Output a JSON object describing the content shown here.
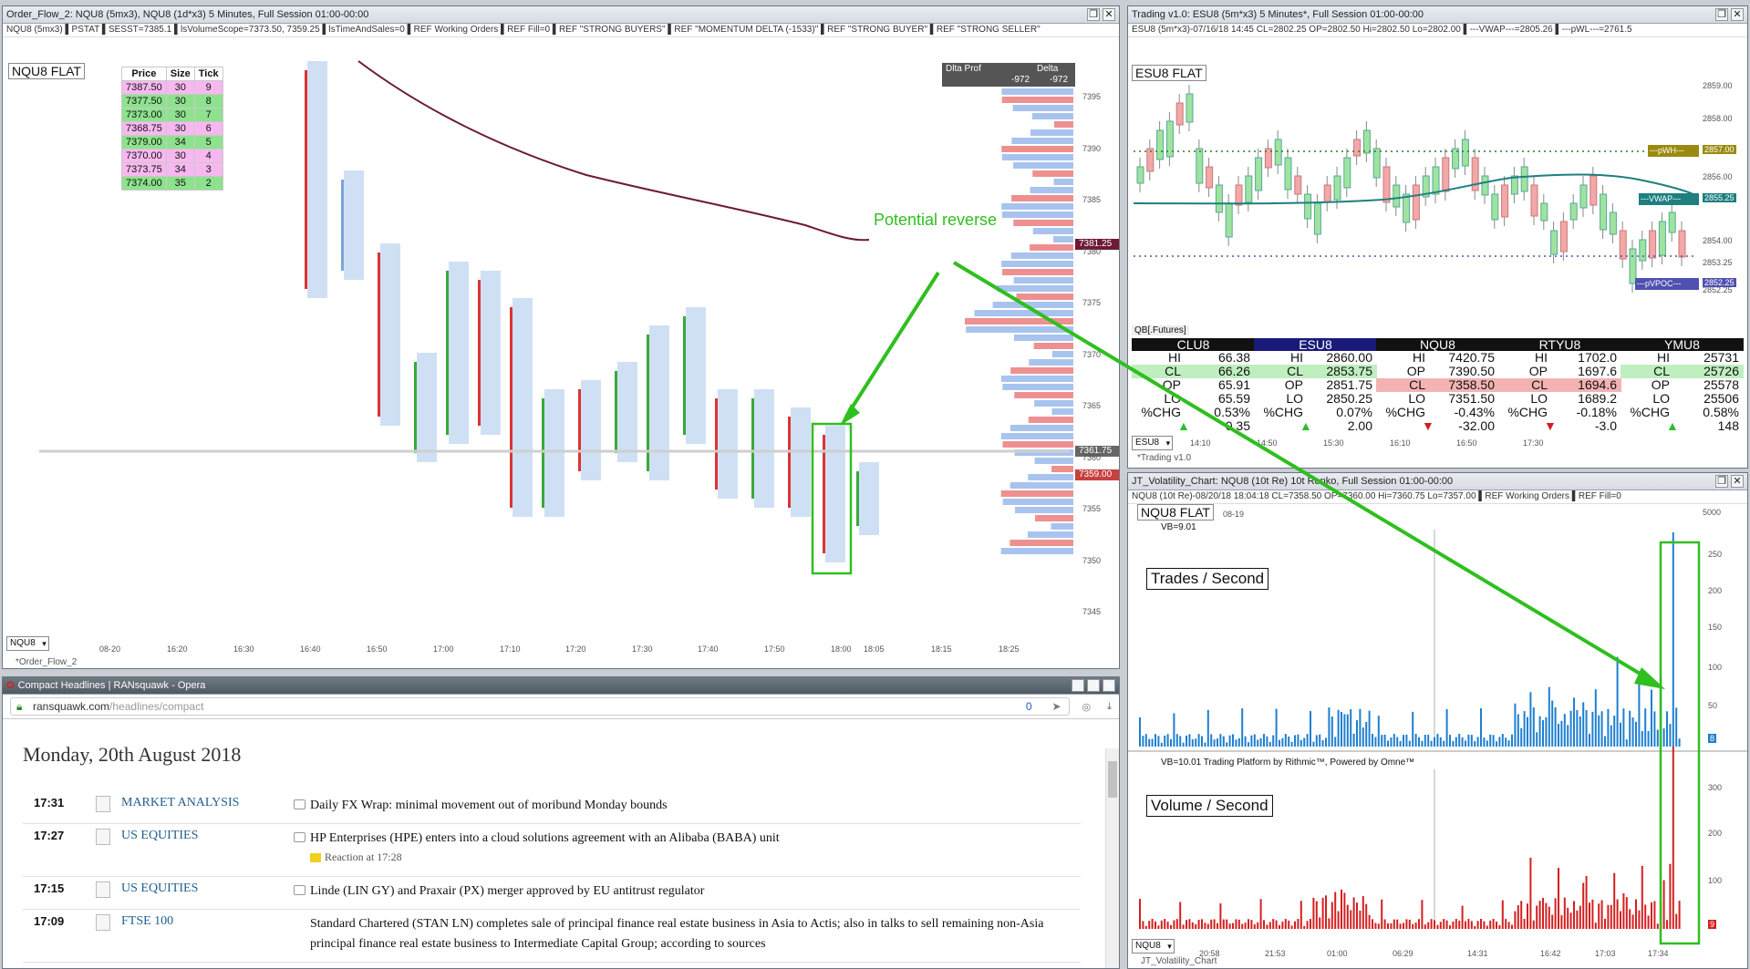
{
  "orderflow": {
    "title": "Order_Flow_2: NQU8 (5mx3), NQU8 (1d*x3) 5 Minutes, Full Session 01:00-00:00",
    "info": "NQU8 (5mx3) ▌PSTAT ▌SESST=7385.1 ▌lsVolumeScope=7373.50, 7359.25 ▌lsTimeAndSales=0 ▌REF Working Orders ▌REF Fill=0 ▌REF \"STRONG BUYERS\" ▌REF \"MOMENTUM DELTA (-1533)\" ▌REF \"STRONG BUYER\" ▌REF \"STRONG SELLER\"",
    "flat": "NQU8 FLAT",
    "table_headers": [
      "Price",
      "Size",
      "Tick"
    ],
    "table_rows": [
      {
        "price": "7387.50",
        "size": "30",
        "tick": "9",
        "color": "pink"
      },
      {
        "price": "7377.50",
        "size": "30",
        "tick": "8",
        "color": "green"
      },
      {
        "price": "7373.00",
        "size": "30",
        "tick": "7",
        "color": "green"
      },
      {
        "price": "7368.75",
        "size": "30",
        "tick": "6",
        "color": "pink"
      },
      {
        "price": "7379.00",
        "size": "34",
        "tick": "5",
        "color": "green"
      },
      {
        "price": "7370.00",
        "size": "30",
        "tick": "4",
        "color": "pink"
      },
      {
        "price": "7373.75",
        "size": "34",
        "tick": "3",
        "color": "pink"
      },
      {
        "price": "7374.00",
        "size": "35",
        "tick": "2",
        "color": "green"
      }
    ],
    "dlta_prof": "Dlta Prof",
    "delta": "Delta",
    "delta_val1": "-972",
    "delta_val2": "-972",
    "annotation": "Potential reverse",
    "price_labels": [
      "7395",
      "7390",
      "7385",
      "7380",
      "7375",
      "7370",
      "7365",
      "7360",
      "7355",
      "7350",
      "7345"
    ],
    "price_tag_1": "7381.25",
    "price_tag_2": "7361.75",
    "price_tag_3": "7359.00",
    "time_labels": [
      "08-20",
      "16:20",
      "16:30",
      "16:40",
      "16:50",
      "17:00",
      "17:10",
      "17:20",
      "17:30",
      "17:40",
      "17:50",
      "18:00",
      "18:05",
      "18:15",
      "18:25"
    ],
    "symbol": "NQU8",
    "tab": "*Order_Flow_2",
    "cell_m": "M"
  },
  "trading": {
    "title": "Trading v1.0: ESU8 (5m*x3) 5 Minutes*, Full Session 01:00-00:00",
    "info": "ESU8 (5m*x3)-07/16/18 14:45 CL=2802.25 OP=2802.50 Hi=2802.50 Lo=2802.00 ▌---VWAP---=2805.26 ▌---pWL---=2761.5",
    "flat": "ESU8 FLAT",
    "price_labels": [
      "2859.00",
      "2858.00",
      "2856.00",
      "2855.25",
      "2854.00",
      "2853.25",
      "2852.25"
    ],
    "tag_pwh": "---pWH---",
    "tag_pwh_val": "2857.00",
    "tag_vwap": "---VWAP---",
    "tag_vwap_val": "2855.25",
    "tag_pvpoc": "---pVPOC---",
    "tag_pvpoc_val": "2852.25",
    "qb_tab": "QB[.Futures]",
    "quotes": [
      {
        "sym": "CLU8",
        "rows": [
          [
            "HI",
            "66.38"
          ],
          [
            "CL",
            "66.26"
          ],
          [
            "OP",
            "65.91"
          ],
          [
            "LO",
            "65.59"
          ],
          [
            "%CHG",
            "0.53%"
          ]
        ],
        "chg": "0.35",
        "dir": "up",
        "hdr": "#111"
      },
      {
        "sym": "ESU8",
        "rows": [
          [
            "HI",
            "2860.00"
          ],
          [
            "CL",
            "2853.75"
          ],
          [
            "OP",
            "2851.75"
          ],
          [
            "LO",
            "2850.25"
          ],
          [
            "%CHG",
            "0.07%"
          ]
        ],
        "chg": "2.00",
        "dir": "up",
        "hdr": "#1a1a7a"
      },
      {
        "sym": "NQU8",
        "rows": [
          [
            "HI",
            "7420.75"
          ],
          [
            "OP",
            "7390.50"
          ],
          [
            "CL",
            "7358.50"
          ],
          [
            "LO",
            "7351.50"
          ],
          [
            "%CHG",
            "-0.43%"
          ]
        ],
        "chg": "-32.00",
        "dir": "down",
        "hdr": "#111"
      },
      {
        "sym": "RTYU8",
        "rows": [
          [
            "HI",
            "1702.0"
          ],
          [
            "OP",
            "1697.6"
          ],
          [
            "CL",
            "1694.6"
          ],
          [
            "LO",
            "1689.2"
          ],
          [
            "%CHG",
            "-0.18%"
          ]
        ],
        "chg": "-3.0",
        "dir": "down",
        "hdr": "#111"
      },
      {
        "sym": "YMU8",
        "rows": [
          [
            "HI",
            "25731"
          ],
          [
            "CL",
            "25726"
          ],
          [
            "OP",
            "25578"
          ],
          [
            "LO",
            "25506"
          ],
          [
            "%CHG",
            "0.58%"
          ]
        ],
        "chg": "148",
        "dir": "up",
        "hdr": "#111"
      }
    ],
    "time_labels": [
      "14:10",
      "14:50",
      "15:30",
      "16:10",
      "16:50",
      "17:30"
    ],
    "symbol": "ESU8",
    "tab": "*Trading v1.0"
  },
  "volatility": {
    "title": "JT_Volatility_Chart: NQU8 (10t Re) 10t Renko, Full Session 01:00-00:00",
    "info": "NQU8 (10t Re)-08/20/18 18:04:18 CL=7358.50 OP=7360.00 Hi=7360.75 Lo=7357.00 ▌REF Working Orders ▌REF Fill=0",
    "flat": "NQU8 FLAT",
    "vb1": "VB=9.01",
    "vb2": "VB=10.01  Trading Platform by Rithmic™, Powered by Omne™",
    "label1": "Trades / Second",
    "label2": "Volume / Second",
    "date": "08-19",
    "top_val": "5000",
    "axis1": [
      "250",
      "200",
      "150",
      "100",
      "50"
    ],
    "axis2": [
      "300",
      "200",
      "100"
    ],
    "last1": "8",
    "last2": "9",
    "time_labels": [
      "20:58",
      "21:53",
      "01:00",
      "06:29",
      "14:31",
      "16:42",
      "17:03",
      "17:34"
    ],
    "symbol": "NQU8",
    "tab": "JT_Volatility_Chart"
  },
  "browser": {
    "title": "Compact Headlines | RANsquawk - Opera",
    "url_host": "ransquawk.com",
    "url_path": "/headlines/compact",
    "badge": "0",
    "date": "Monday, 20th August 2018",
    "headlines": [
      {
        "time": "17:31",
        "cat": "MARKET ANALYSIS",
        "text": "Daily FX Wrap: minimal movement out of moribund Monday bounds",
        "reaction": ""
      },
      {
        "time": "17:27",
        "cat": "US EQUITIES",
        "text": "HP Enterprises (HPE) enters into a cloud solutions agreement with an Alibaba (BABA) unit",
        "reaction": "Reaction at 17:28"
      },
      {
        "time": "17:15",
        "cat": "US EQUITIES",
        "text": "Linde (LIN GY) and Praxair (PX) merger approved by EU antitrust regulator",
        "reaction": ""
      },
      {
        "time": "17:09",
        "cat": "FTSE 100",
        "text": "Standard Chartered (STAN LN) completes sale of principal finance real estate business in Asia to Actis; also in talks to sell remaining non-Asia principal finance real estate business to Intermediate Capital Group; according to sources",
        "reaction": ""
      }
    ]
  },
  "colors": {
    "green_annotation": "#2fbf1f",
    "volume_red": "#d42020",
    "trades_blue": "#1f7fd0",
    "vwap_teal": "#1d7f7f",
    "ma_maroon": "#6e1a34"
  }
}
